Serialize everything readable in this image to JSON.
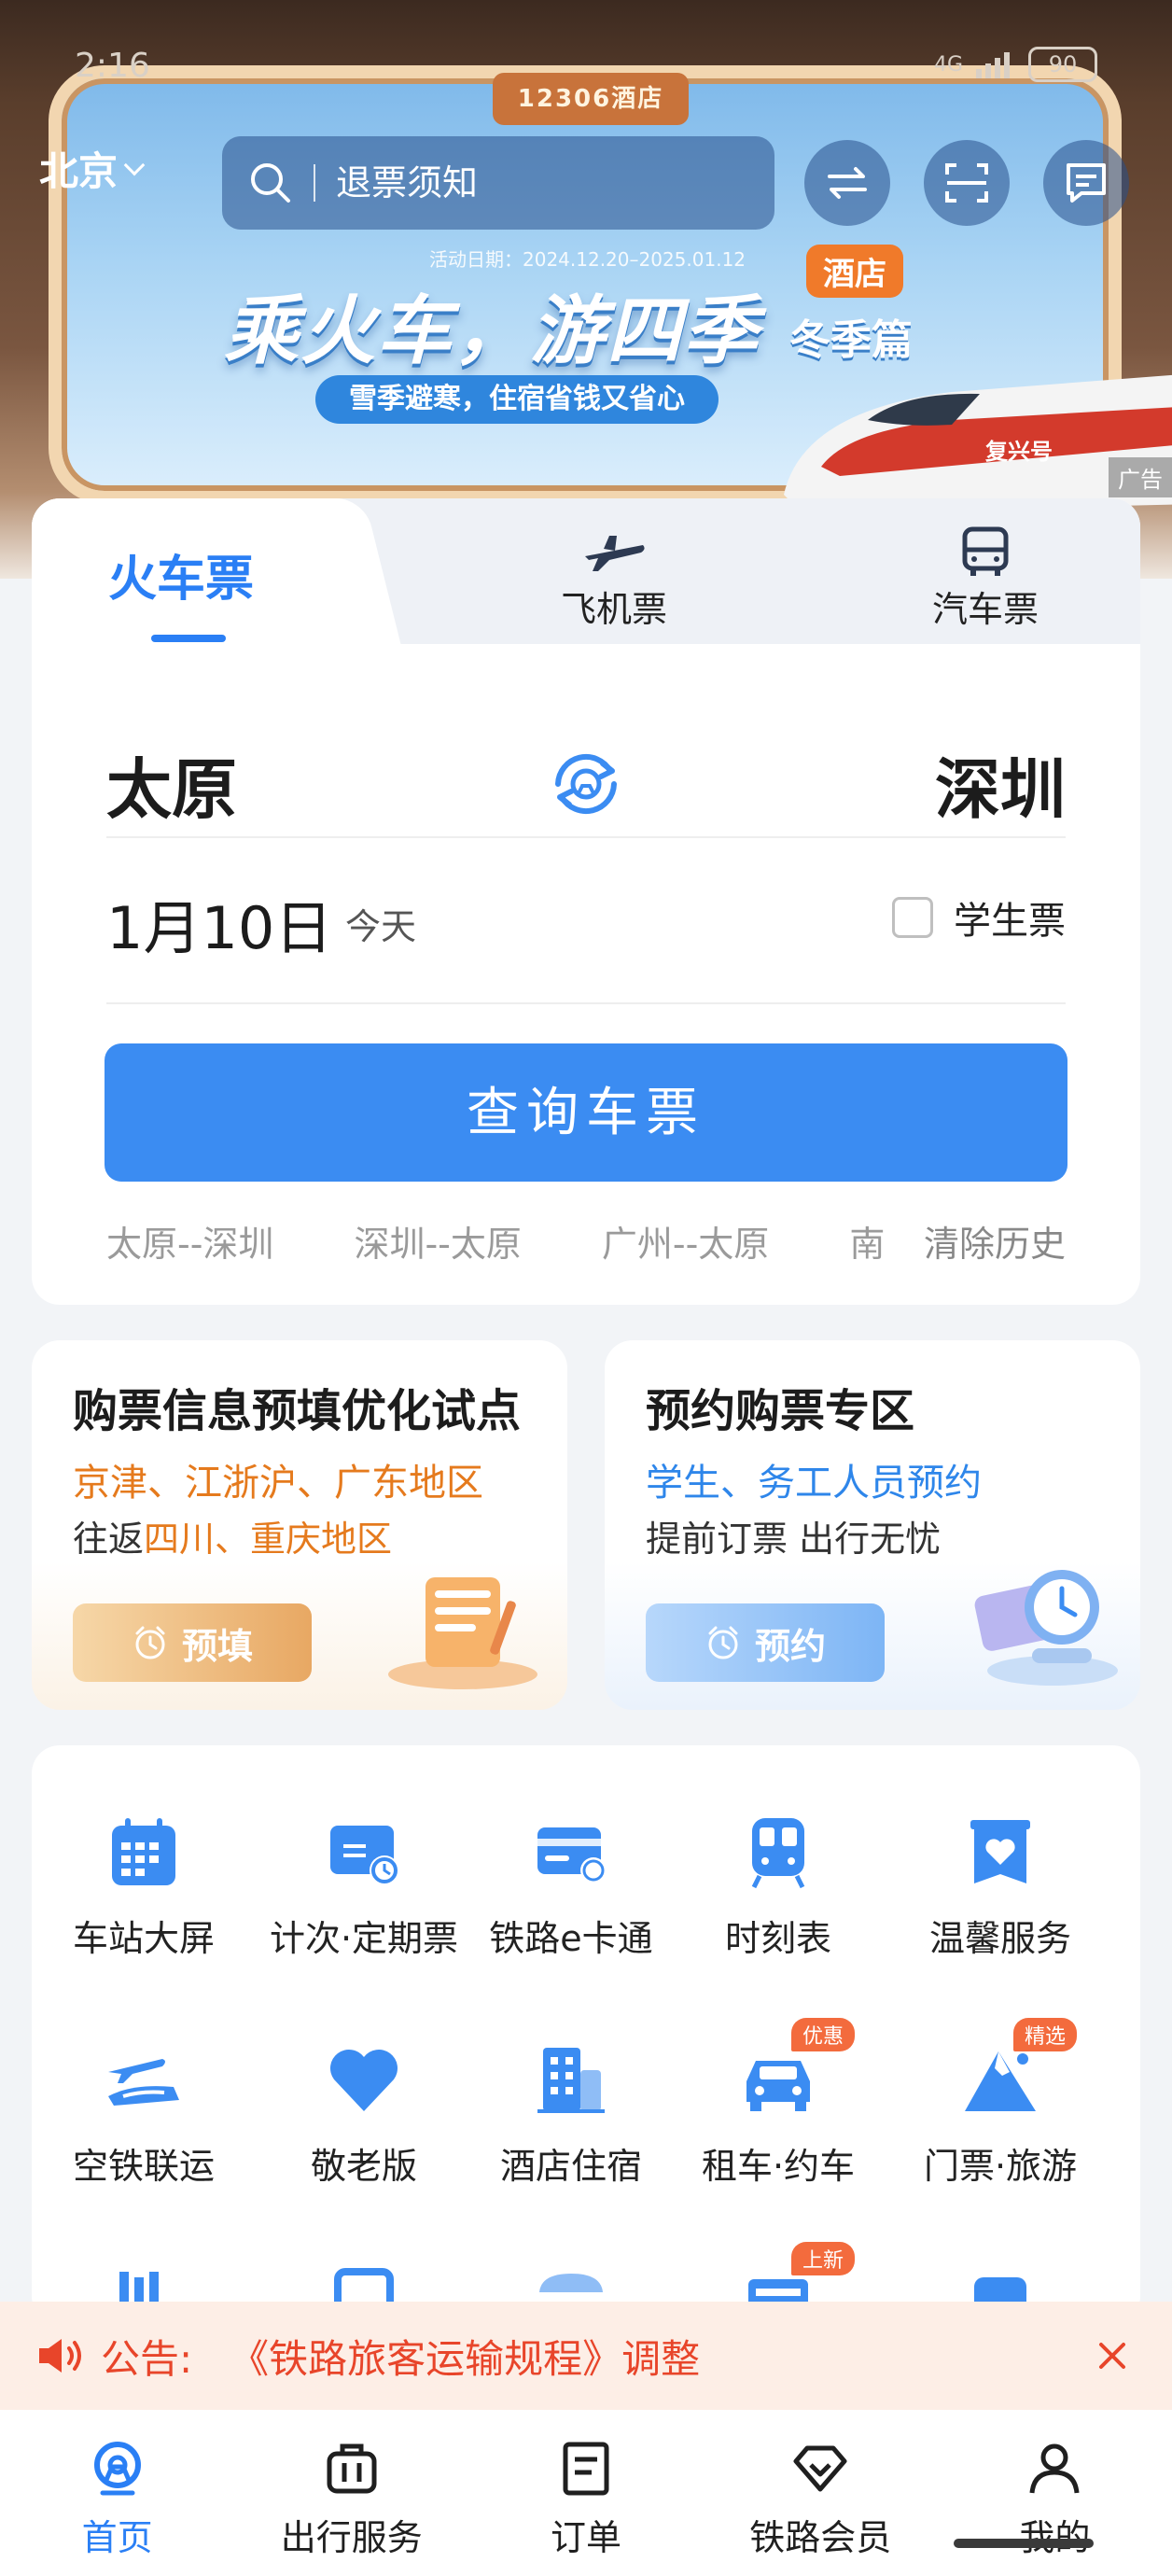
{
  "status_bar": {
    "time": "2:16",
    "network": "4G",
    "battery": "90"
  },
  "header": {
    "city": "北京",
    "search_placeholder": "退票须知"
  },
  "banner": {
    "tag": "12306酒店",
    "date": "活动日期：2024.12.20–2025.01.12",
    "title": "乘火车，游四季",
    "season": "冬季篇",
    "badge": "酒店",
    "subtitle": "雪季避寒，住宿省钱又省心",
    "train_label": "复兴号",
    "ad_mark": "广告"
  },
  "ticket": {
    "tabs": [
      "火车票",
      "飞机票",
      "汽车票"
    ],
    "from": "太原",
    "to": "深圳",
    "date": "1月10日",
    "date_hint": "今天",
    "student_label": "学生票",
    "student_checked": false,
    "query_button": "查询车票",
    "history": [
      "太原--深圳",
      "深圳--太原",
      "广州--太原",
      "南"
    ],
    "clear_history": "清除历史"
  },
  "promos": [
    {
      "title": "购票信息预填优化试点",
      "line1": "京津、江浙沪、广东地区",
      "line2_prefix": "往返",
      "line2_highlight": "四川、重庆地区",
      "button": "预填"
    },
    {
      "title": "预约购票专区",
      "line1": "学生、务工人员预约",
      "line2": "提前订票 出行无忧",
      "button": "预约"
    }
  ],
  "services": [
    {
      "label": "车站大屏",
      "icon": "calendar-grid-icon"
    },
    {
      "label": "计次·定期票",
      "icon": "ticket-clock-icon"
    },
    {
      "label": "铁路e卡通",
      "icon": "railway-card-icon"
    },
    {
      "label": "时刻表",
      "icon": "train-front-icon"
    },
    {
      "label": "温馨服务",
      "icon": "heart-box-icon"
    },
    {
      "label": "空铁联运",
      "icon": "plane-train-icon"
    },
    {
      "label": "敬老版",
      "icon": "heart-icon"
    },
    {
      "label": "酒店住宿",
      "icon": "hotel-building-icon"
    },
    {
      "label": "租车·约车",
      "icon": "car-icon",
      "tag": "优惠"
    },
    {
      "label": "门票·旅游",
      "icon": "mountain-icon",
      "tag": "精选"
    }
  ],
  "services_partial_tag": "上新",
  "notice": {
    "label": "公告:",
    "text": "《铁路旅客运输规程》调整"
  },
  "bottom_nav": [
    "首页",
    "出行服务",
    "订单",
    "铁路会员",
    "我的"
  ],
  "colors": {
    "primary": "#2a7ff5",
    "button": "#3b8cf2",
    "orange": "#e57a1d",
    "notice_red": "#e8452a"
  }
}
